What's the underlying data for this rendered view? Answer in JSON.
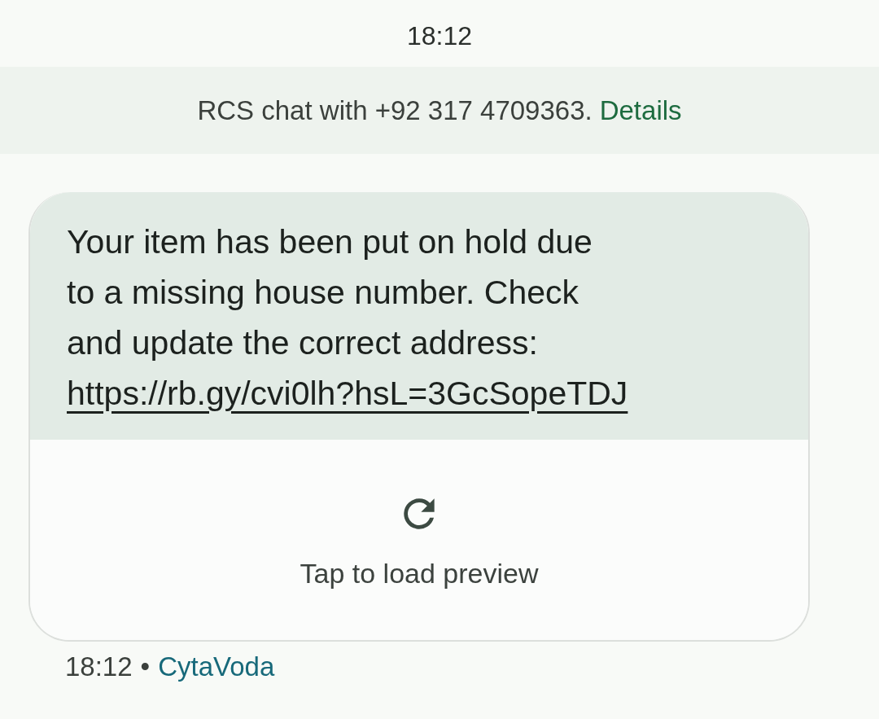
{
  "status_time": "18:12",
  "banner": {
    "text": "RCS chat with +92 317 4709363.",
    "link": "Details"
  },
  "message": {
    "text": "Your item has been put on hold due\nto a missing house number. Check\nand update the correct address:",
    "link": "https://rb.gy/cvi0lh?hsL=3GcSopeTDJ",
    "preview": {
      "label": "Tap to load preview"
    }
  },
  "footer": {
    "time": "18:12",
    "separator": "•",
    "sender": "CytaVoda"
  }
}
